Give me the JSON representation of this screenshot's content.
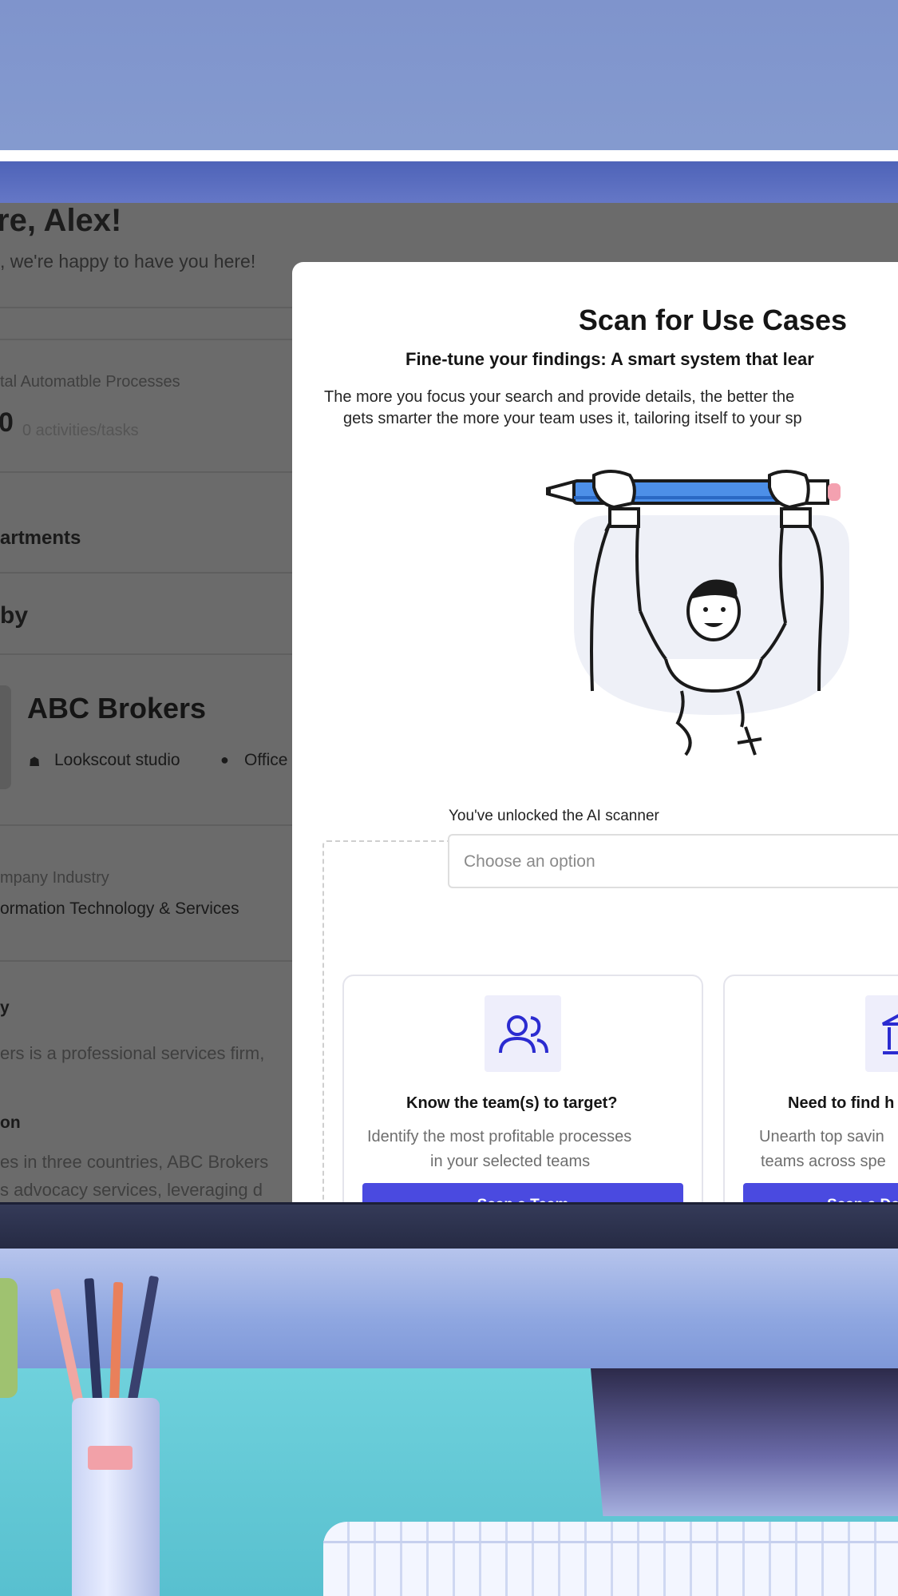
{
  "background_page": {
    "greeting": "re, Alex!",
    "subtitle": ", we're happy to have you here!",
    "stat_label": "tal Automatble Processes",
    "stat_value": "0",
    "stat_unit": "0 activities/tasks",
    "section_departments": "artments",
    "section_2": "by",
    "company_name": "ABC Brokers",
    "company_location": "Lookscout studio",
    "company_office": "Office",
    "industry_label": "mpany Industry",
    "industry_value": "ormation Technology & Services",
    "about_label": "y",
    "about_text": "ers is a professional services firm,",
    "mission_label": "on",
    "mission_text_1": "es in three countries, ABC Brokers",
    "mission_text_2": "s advocacy services, leveraging d"
  },
  "modal": {
    "title": "Scan for Use Cases",
    "subtitle": "Fine-tune your findings: A smart system that lear",
    "description_line1": "The more you focus your search and provide details, the better the",
    "description_line2": "gets smarter the more your team uses it, tailoring itself to your sp",
    "scanner_label": "You've unlocked the AI scanner",
    "select_placeholder": "Choose an option",
    "cards": [
      {
        "icon": "users-icon",
        "title": "Know the team(s) to target?",
        "text_line1": "Identify the most profitable processes",
        "text_line2": "in your selected teams",
        "button": "Scan a Team"
      },
      {
        "icon": "building-icon",
        "title": "Need to find h",
        "text_line1": "Unearth top savin",
        "text_line2": "teams across spe",
        "button": "Scan a De"
      }
    ]
  },
  "colors": {
    "primary_button": "#4a4ae0",
    "icon_tile": "#eeeefb",
    "pencil_blue": "#4d8fe8",
    "pencil_eraser": "#f4a1b0"
  }
}
